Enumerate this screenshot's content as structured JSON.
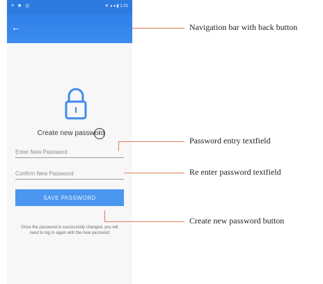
{
  "status": {
    "left_icons": "≡ ■ ◎",
    "right_icons": "▼ ◂ ◂ ▮ 1:31"
  },
  "navbar": {
    "back_icon": "arrow-back-icon",
    "back_label": "←"
  },
  "screen": {
    "lock_icon": "lock-icon",
    "title": "Create new password",
    "info_icon": "info-icon",
    "info_label": "i",
    "new_password_placeholder": "Enter New Password",
    "confirm_password_placeholder": "Confirm New Password",
    "save_label": "SAVE PASSWORD",
    "hint": "Once the password is successfully changed, you will need to log in again with the new password"
  },
  "annotations": {
    "nav": "Navigation bar with back button",
    "pwd": "Password entry textfield",
    "reenter": "Re enter password textfield",
    "createbtn": "Create new password button"
  },
  "colors": {
    "primary": "#2f80e9",
    "button": "#4a96f0",
    "annotation_line": "#e07c59"
  }
}
